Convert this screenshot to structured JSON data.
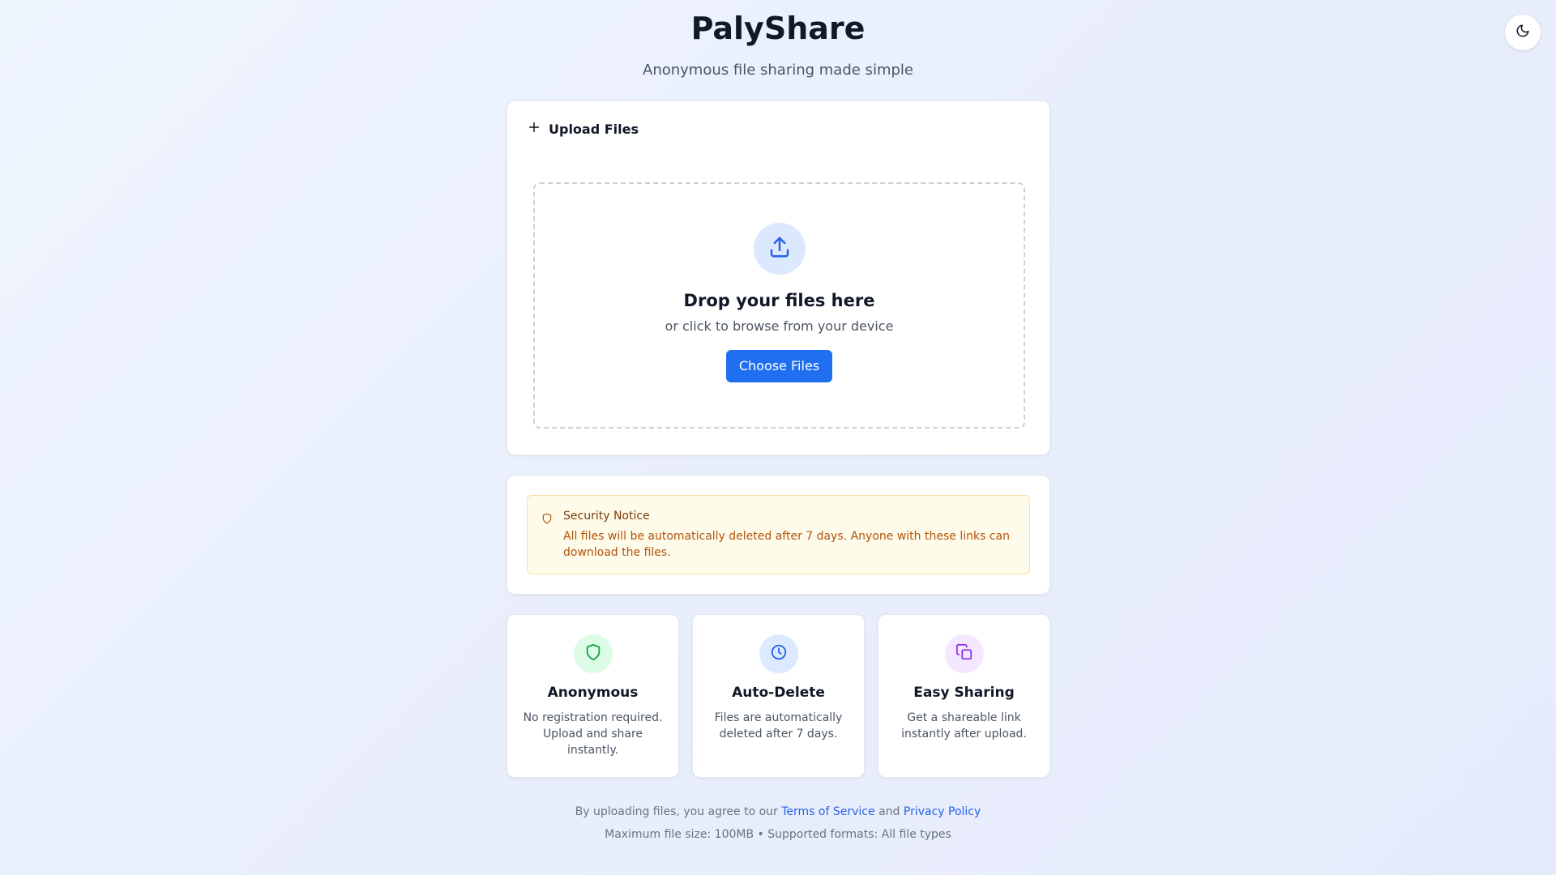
{
  "app": {
    "title": "PalyShare",
    "subtitle": "Anonymous file sharing made simple"
  },
  "theme_toggle": {
    "icon": "moon-icon"
  },
  "upload": {
    "header_icon": "plus-icon",
    "header_label": "Upload Files",
    "drop_icon": "upload-icon",
    "drop_title": "Drop your files here",
    "drop_subtitle": "or click to browse from your device",
    "button_label": "Choose Files"
  },
  "security_notice": {
    "icon": "shield-icon",
    "title": "Security Notice",
    "text": "All files will be automatically deleted after 7 days. Anyone with these links can download the files."
  },
  "features": [
    {
      "icon": "shield-icon",
      "title": "Anonymous",
      "text": "No registration required. Upload and share instantly.",
      "color": "#16a34a",
      "bg": "#dcfce7"
    },
    {
      "icon": "clock-icon",
      "title": "Auto-Delete",
      "text": "Files are automatically deleted after 7 days.",
      "color": "#2563eb",
      "bg": "#dbeafe"
    },
    {
      "icon": "copy-icon",
      "title": "Easy Sharing",
      "text": "Get a shareable link instantly after upload.",
      "color": "#9333ea",
      "bg": "#f3e8ff"
    }
  ],
  "footer": {
    "agree_prefix": "By uploading files, you agree to our",
    "terms_link": "Terms of Service",
    "and": "and",
    "privacy_link": "Privacy Policy",
    "limits": "Maximum file size: 100MB • Supported formats: All file types"
  },
  "colors": {
    "accent": "#1f6ff0",
    "notice_bg": "#fefbea",
    "notice_text": "#b45309"
  }
}
